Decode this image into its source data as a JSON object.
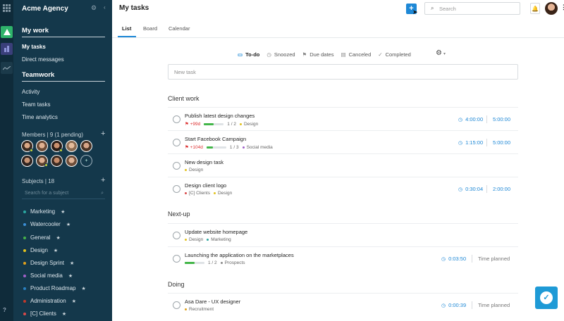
{
  "sidebar": {
    "workspace": "Acme Agency",
    "my_work": "My work",
    "my_tasks": "My tasks",
    "direct_messages": "Direct messages",
    "teamwork": "Teamwork",
    "activity": "Activity",
    "team_tasks": "Team tasks",
    "time_analytics": "Time analytics",
    "members_label": "Members | 9 (1 pending)",
    "subjects_label": "Subjects | 18",
    "subject_search_placeholder": "Search for a subject",
    "subjects": [
      {
        "name": "Marketing",
        "color": "#2aa7a0"
      },
      {
        "name": "Watercooler",
        "color": "#3b8fd6"
      },
      {
        "name": "General",
        "color": "#46b04a"
      },
      {
        "name": "Design",
        "color": "#e3c21e"
      },
      {
        "name": "Design Sprint",
        "color": "#e0a11c"
      },
      {
        "name": "Social media",
        "color": "#a060c8"
      },
      {
        "name": "Product Roadmap",
        "color": "#2a80c0"
      },
      {
        "name": "Administration",
        "color": "#c0392b"
      },
      {
        "name": "[C] Clients",
        "color": "#d84a4a"
      }
    ],
    "help": "?"
  },
  "header": {
    "title": "My tasks",
    "search_placeholder": "Search"
  },
  "tabs": [
    "List",
    "Board",
    "Calendar"
  ],
  "filters": [
    "To-do",
    "Snoozed",
    "Due dates",
    "Canceled",
    "Completed"
  ],
  "new_task_placeholder": "New task",
  "groups": [
    {
      "title": "Client work"
    },
    {
      "title": "Next-up"
    },
    {
      "title": "Doing"
    }
  ],
  "tasks": [
    {
      "title": "Publish latest design changes",
      "due": "+99d",
      "progress": "1 / 2",
      "progress_value": 0.5,
      "tag": "Design",
      "tag_color": "#e3c21e",
      "tracked": "4:00:00",
      "planned": "5:00:00"
    },
    {
      "title": "Start Facebook Campaign",
      "due": "+104d",
      "progress": "1 / 3",
      "progress_value": 0.33,
      "tag": "Social media",
      "tag_color": "#a060c8",
      "tracked": "1:15:00",
      "planned": "5:00:00"
    },
    {
      "title": "New design task",
      "tag": "Design",
      "tag_color": "#e3c21e"
    },
    {
      "title": "Design client logo",
      "tag": "[C] Clients",
      "tag_color": "#d84a4a",
      "tag2": "Design",
      "tag2_color": "#e3c21e",
      "tracked": "0:30:04",
      "planned": "2:00:00"
    },
    {
      "title": "Update website homepage",
      "tag": "Design",
      "tag_color": "#e3c21e",
      "tag2": "Marketing",
      "tag2_color": "#2aa7a0"
    },
    {
      "title": "Launching the application on the marketplaces",
      "progress": "1 / 2",
      "progress_value": 0.5,
      "tag": "Prospects",
      "tag_color": "#888888",
      "tracked": "0:03:50",
      "planned": "Time planned"
    },
    {
      "title": "Asa Dare - UX designer",
      "tag": "Recruitment",
      "tag_color": "#e0a11c",
      "tracked": "0:00:39",
      "planned": "Time planned"
    }
  ],
  "colors": {
    "accent": "#1e88d6",
    "sidebar": "#14384b",
    "rail": "#0f2b3a",
    "progress": "#43b649"
  }
}
